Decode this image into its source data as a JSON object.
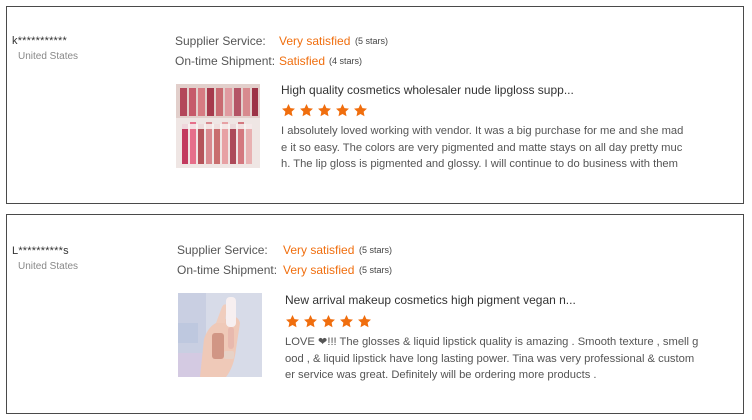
{
  "colors": {
    "accent": "#f06e0e",
    "border": "#4a4a4a",
    "muted": "#888888"
  },
  "reviews": [
    {
      "buyer": "k***********",
      "country": "United States",
      "supplier_label": "Supplier Service:",
      "supplier_value": "Very satisfied",
      "supplier_stars": "(5 stars)",
      "shipment_label": "On-time Shipment:",
      "shipment_value": "Satisfied",
      "shipment_stars": "(4 stars)",
      "product_title": "High quality cosmetics wholesaler nude lipgloss supp...",
      "rating": 5,
      "text": "I absolutely loved working with vendor. It was a big purchase for me and she made it so easy. The colors are very pigmented and matte stays on all day pretty much. The lip gloss is pigmented and glossy. I will continue to do business with them",
      "thumb_icon": "lipgloss-swatch-photo"
    },
    {
      "buyer": "L**********s",
      "country": "United States",
      "supplier_label": "Supplier Service:",
      "supplier_value": "Very satisfied",
      "supplier_stars": "(5 stars)",
      "shipment_label": "On-time Shipment:",
      "shipment_value": "Very satisfied",
      "shipment_stars": "(5 stars)",
      "product_title": "New arrival makeup cosmetics high pigment vegan n...",
      "rating": 5,
      "text": "LOVE ❤!!! The glosses & liquid lipstick quality is amazing . Smooth texture , smell good , & liquid lipstick have long lasting power. Tina was very professional & customer service was great. Definitely will be ordering more products .",
      "thumb_icon": "hand-swatch-photo"
    }
  ]
}
